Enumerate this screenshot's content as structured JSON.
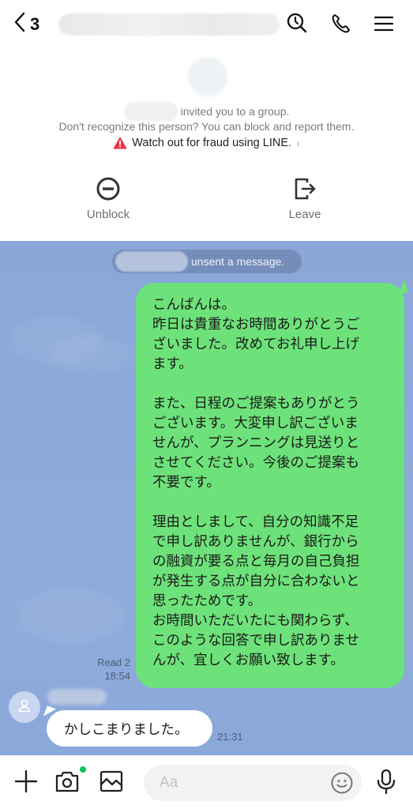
{
  "header": {
    "back_count": "3",
    "icons": [
      "back-chevron-icon",
      "search-history-icon",
      "phone-icon",
      "menu-icon"
    ]
  },
  "invite": {
    "invited_text": "invited you to a group.",
    "unknown_text": "Don't recognize this person? You can block and report them.",
    "fraud_warning": "Watch out for fraud using LINE.",
    "fraud_chevron": "›",
    "actions": [
      {
        "label": "Unblock",
        "icon": "block-minus-circle-icon"
      },
      {
        "label": "Leave",
        "icon": "exit-arrow-icon"
      }
    ]
  },
  "chat": {
    "system_message": "unsent a message.",
    "outgoing": {
      "lines": [
        "こんばんは。",
        "昨日は貴重なお時間ありがとうご",
        "ざいました。改めてお礼申し上げ",
        "ます。",
        "",
        "また、日程のご提案もありがとう",
        "ございます。大変申し訳ございま",
        "せんが、プランニングは見送りと",
        "させてください。今後のご提案も",
        "不要です。",
        "",
        "理由としまして、自分の知識不足",
        "で申し訳ありませんが、銀行から",
        "の融資が要る点と毎月の自己負担",
        "が発生する点が自分に合わないと",
        "思ったためです。",
        "お時間いただいたにも関わらず、",
        "このような回答で申し訳ありませ",
        "んが、宜しくお願い致します。"
      ],
      "read_status": "Read 2",
      "time": "18:54",
      "color": "#6ee27a"
    },
    "incoming": {
      "text": "かしこまりました。",
      "time": "21:31"
    },
    "background_color": "#8aa8d9"
  },
  "composer": {
    "placeholder": "Aa",
    "value": "",
    "icons": [
      "plus-icon",
      "camera-icon",
      "image-icon",
      "emoji-icon",
      "microphone-icon"
    ],
    "camera_badge_color": "#06c755"
  }
}
